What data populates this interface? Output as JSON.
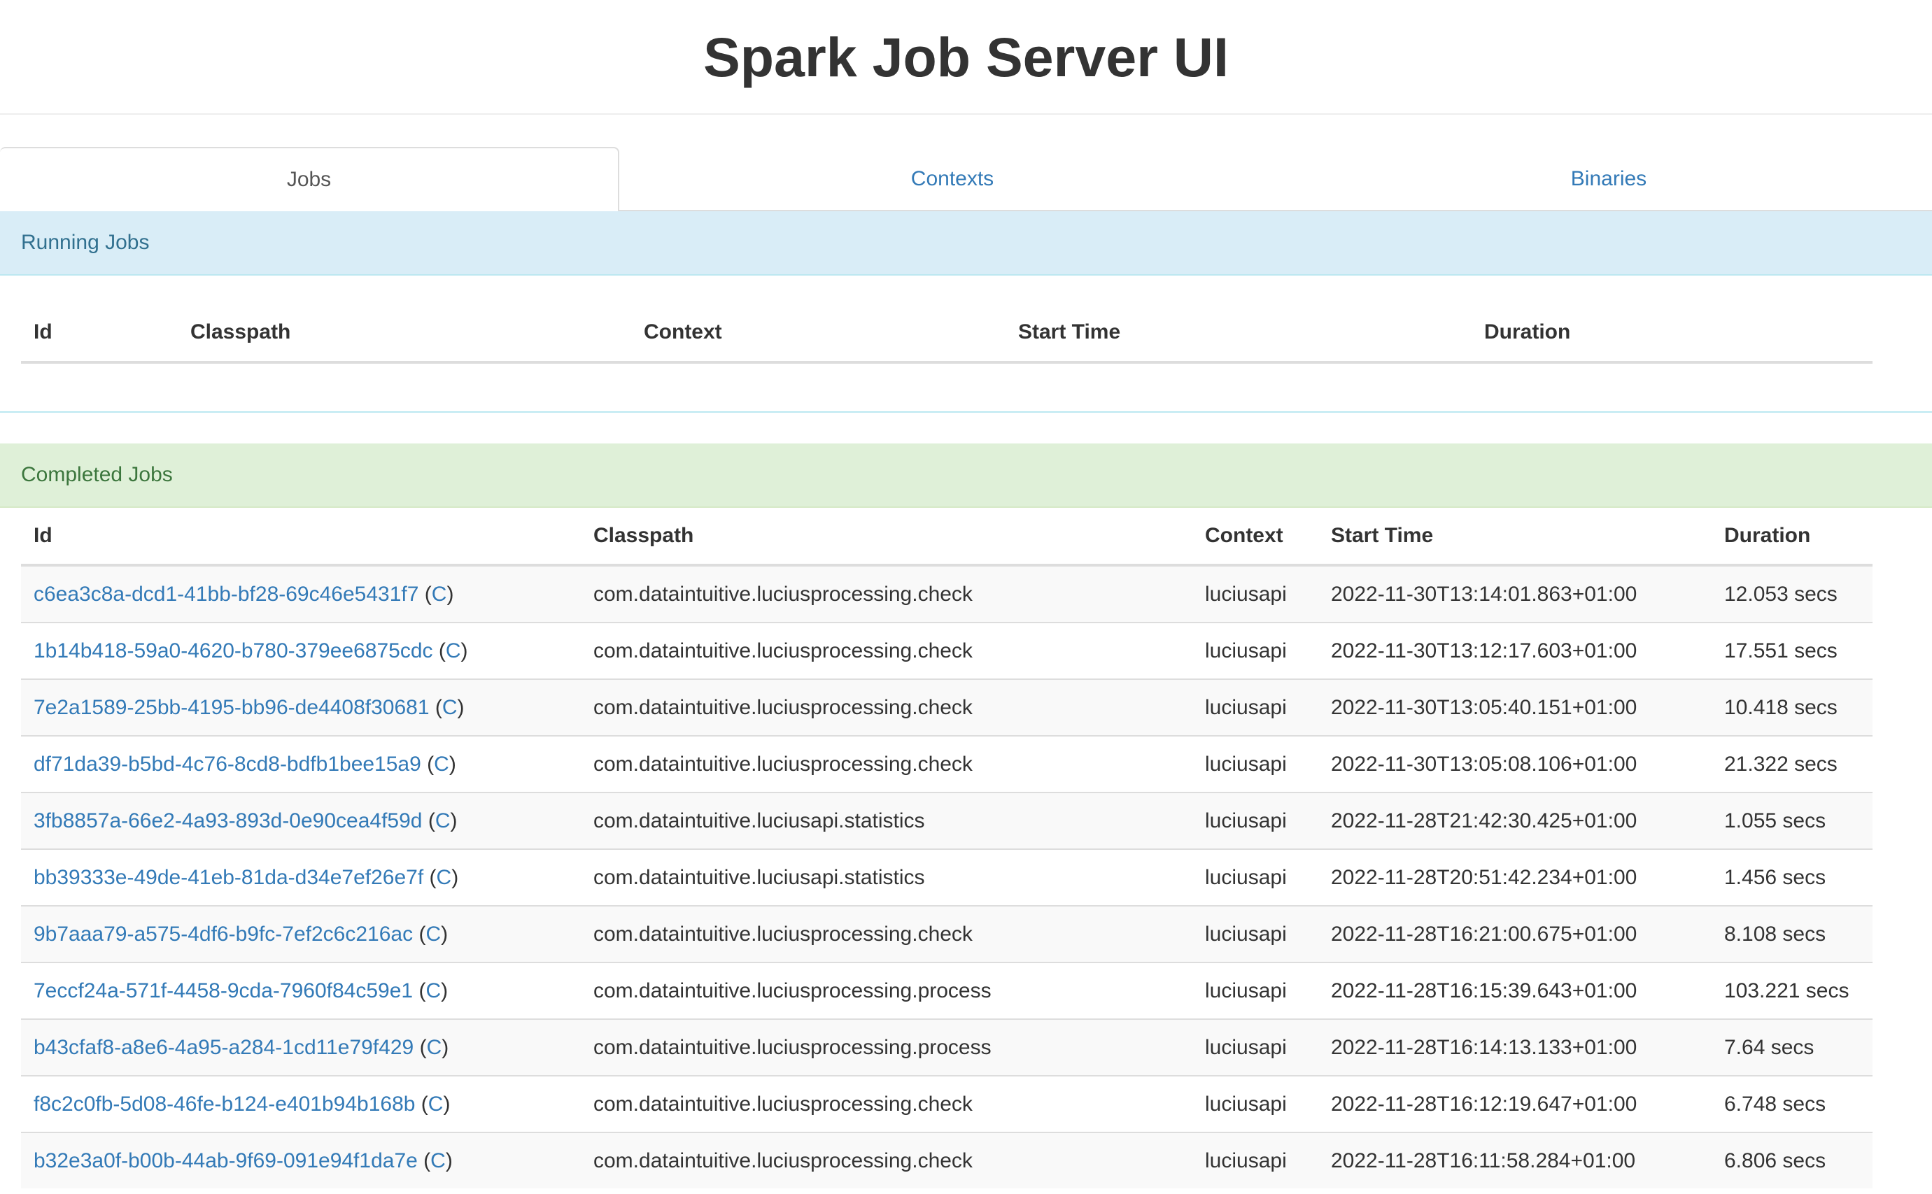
{
  "app": {
    "title": "Spark Job Server UI"
  },
  "tabs": [
    {
      "label": "Jobs"
    },
    {
      "label": "Contexts"
    },
    {
      "label": "Binaries"
    }
  ],
  "running": {
    "heading": "Running Jobs",
    "columns": {
      "id": "Id",
      "classpath": "Classpath",
      "context": "Context",
      "start_time": "Start Time",
      "duration": "Duration"
    }
  },
  "completed": {
    "heading": "Completed Jobs",
    "columns": {
      "id": "Id",
      "classpath": "Classpath",
      "context": "Context",
      "start_time": "Start Time",
      "duration": "Duration"
    },
    "rows": [
      {
        "id": "c6ea3c8a-dcd1-41bb-bf28-69c46e5431f7",
        "c_label": "C",
        "classpath": "com.dataintuitive.luciusprocessing.check",
        "context": "luciusapi",
        "start_time": "2022-11-30T13:14:01.863+01:00",
        "duration": "12.053 secs"
      },
      {
        "id": "1b14b418-59a0-4620-b780-379ee6875cdc",
        "c_label": "C",
        "classpath": "com.dataintuitive.luciusprocessing.check",
        "context": "luciusapi",
        "start_time": "2022-11-30T13:12:17.603+01:00",
        "duration": "17.551 secs"
      },
      {
        "id": "7e2a1589-25bb-4195-bb96-de4408f30681",
        "c_label": "C",
        "classpath": "com.dataintuitive.luciusprocessing.check",
        "context": "luciusapi",
        "start_time": "2022-11-30T13:05:40.151+01:00",
        "duration": "10.418 secs"
      },
      {
        "id": "df71da39-b5bd-4c76-8cd8-bdfb1bee15a9",
        "c_label": "C",
        "classpath": "com.dataintuitive.luciusprocessing.check",
        "context": "luciusapi",
        "start_time": "2022-11-30T13:05:08.106+01:00",
        "duration": "21.322 secs"
      },
      {
        "id": "3fb8857a-66e2-4a93-893d-0e90cea4f59d",
        "c_label": "C",
        "classpath": "com.dataintuitive.luciusapi.statistics",
        "context": "luciusapi",
        "start_time": "2022-11-28T21:42:30.425+01:00",
        "duration": "1.055 secs"
      },
      {
        "id": "bb39333e-49de-41eb-81da-d34e7ef26e7f",
        "c_label": "C",
        "classpath": "com.dataintuitive.luciusapi.statistics",
        "context": "luciusapi",
        "start_time": "2022-11-28T20:51:42.234+01:00",
        "duration": "1.456 secs"
      },
      {
        "id": "9b7aaa79-a575-4df6-b9fc-7ef2c6c216ac",
        "c_label": "C",
        "classpath": "com.dataintuitive.luciusprocessing.check",
        "context": "luciusapi",
        "start_time": "2022-11-28T16:21:00.675+01:00",
        "duration": "8.108 secs"
      },
      {
        "id": "7eccf24a-571f-4458-9cda-7960f84c59e1",
        "c_label": "C",
        "classpath": "com.dataintuitive.luciusprocessing.process",
        "context": "luciusapi",
        "start_time": "2022-11-28T16:15:39.643+01:00",
        "duration": "103.221 secs"
      },
      {
        "id": "b43cfaf8-a8e6-4a95-a284-1cd11e79f429",
        "c_label": "C",
        "classpath": "com.dataintuitive.luciusprocessing.process",
        "context": "luciusapi",
        "start_time": "2022-11-28T16:14:13.133+01:00",
        "duration": "7.64 secs"
      },
      {
        "id": "f8c2c0fb-5d08-46fe-b124-e401b94b168b",
        "c_label": "C",
        "classpath": "com.dataintuitive.luciusprocessing.check",
        "context": "luciusapi",
        "start_time": "2022-11-28T16:12:19.647+01:00",
        "duration": "6.748 secs"
      },
      {
        "id": "b32e3a0f-b00b-44ab-9f69-091e94f1da7e",
        "c_label": "C",
        "classpath": "com.dataintuitive.luciusprocessing.check",
        "context": "luciusapi",
        "start_time": "2022-11-28T16:11:58.284+01:00",
        "duration": "6.806 secs"
      }
    ]
  }
}
